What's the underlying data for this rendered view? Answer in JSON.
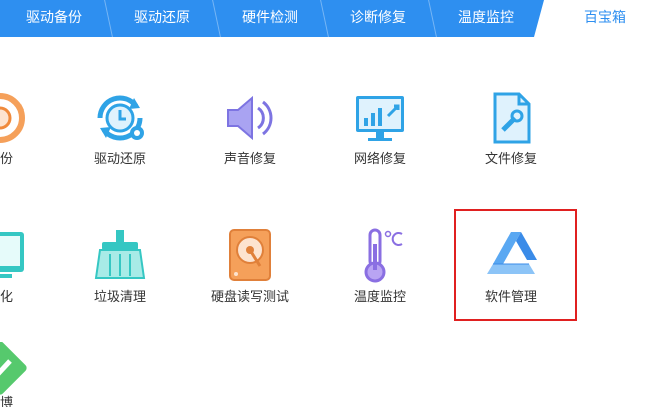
{
  "tabs": [
    {
      "label": "驱动备份"
    },
    {
      "label": "驱动还原"
    },
    {
      "label": "硬件检测"
    },
    {
      "label": "诊断修复"
    },
    {
      "label": "温度监控"
    }
  ],
  "active_tab": {
    "label": "百宝箱"
  },
  "tools": {
    "row1": [
      {
        "label": "备份",
        "icon": "driver-backup-icon"
      },
      {
        "label": "驱动还原",
        "icon": "driver-restore-icon"
      },
      {
        "label": "声音修复",
        "icon": "speaker-icon"
      },
      {
        "label": "网络修复",
        "icon": "network-monitor-icon"
      },
      {
        "label": "文件修复",
        "icon": "file-wrench-icon"
      }
    ],
    "row2": [
      {
        "label": "优化",
        "icon": "optimize-icon"
      },
      {
        "label": "垃圾清理",
        "icon": "broom-icon"
      },
      {
        "label": "硬盘读写测试",
        "icon": "hard-disk-icon"
      },
      {
        "label": "温度监控",
        "icon": "thermometer-icon"
      },
      {
        "label": "软件管理",
        "icon": "software-manager-icon"
      }
    ],
    "row3": [
      {
        "label": "方博",
        "icon": "green-check-icon"
      }
    ]
  },
  "colors": {
    "tab_bar": "#2e8ff0",
    "highlight_border": "#e02020",
    "label_text": "#333333"
  }
}
